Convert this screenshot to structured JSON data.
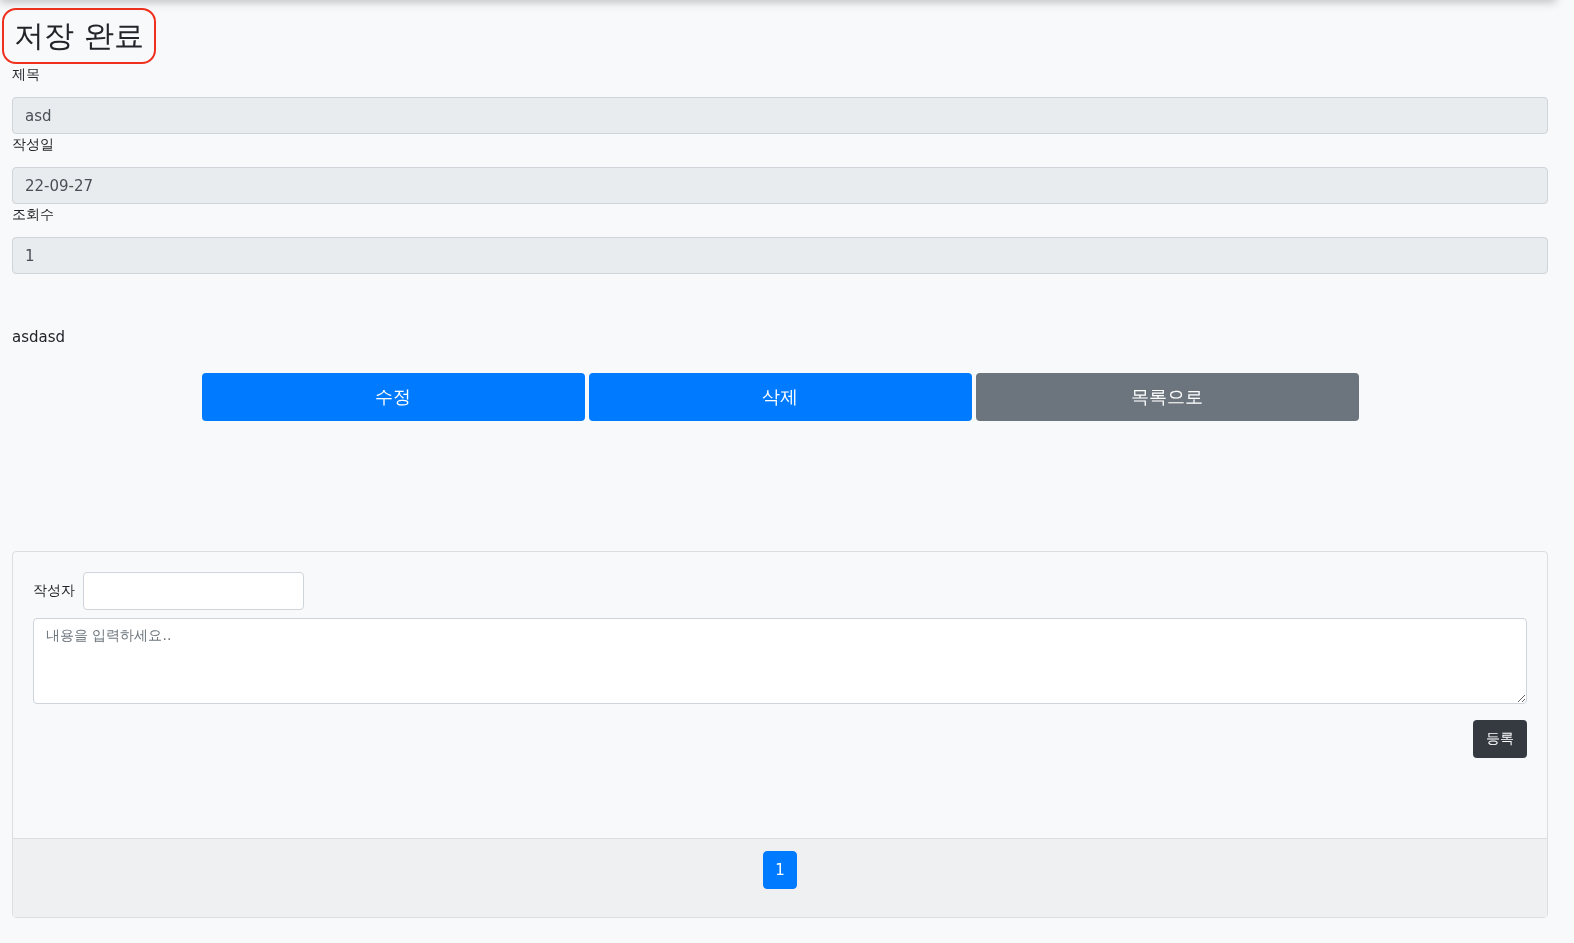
{
  "heading": "저장 완료",
  "fields": [
    {
      "label": "제목",
      "value": "asd"
    },
    {
      "label": "작성일",
      "value": "22-09-27"
    },
    {
      "label": "조회수",
      "value": "1"
    }
  ],
  "content": "asdasd",
  "actions": [
    {
      "label": "수정",
      "kind": "primary"
    },
    {
      "label": "삭제",
      "kind": "primary"
    },
    {
      "label": "목록으로",
      "kind": "secondary"
    }
  ],
  "comment_form": {
    "author_label": "작성자",
    "content_placeholder": "내용을 입력하세요..",
    "submit": "등록"
  },
  "pagination": [
    {
      "label": "1",
      "selected": true
    }
  ]
}
